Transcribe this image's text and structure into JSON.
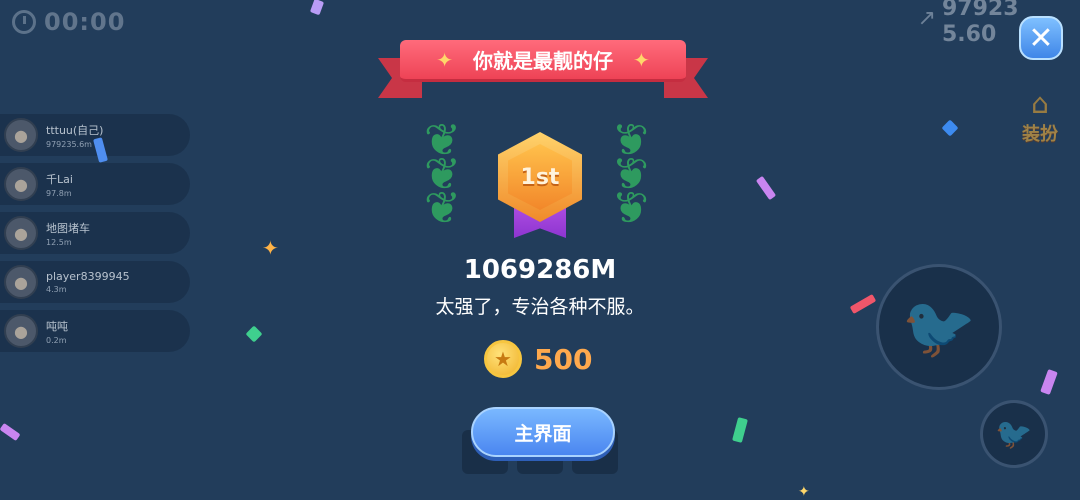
{
  "hud": {
    "timer": "00:00",
    "distance": "979235.60",
    "dress_up_label": "装扮"
  },
  "leaderboard": [
    {
      "name": "tttuu(自己)",
      "score": "979235.6m"
    },
    {
      "name": "千Lai",
      "score": "97.8m"
    },
    {
      "name": "地图堵车",
      "score": "12.5m"
    },
    {
      "name": "player8399945",
      "score": "4.3m"
    },
    {
      "name": "吨吨",
      "score": "0.2m"
    }
  ],
  "result": {
    "banner_title": "你就是最靓的仔",
    "rank_badge": "1st",
    "score": "1069286M",
    "message": "太强了，专治各种不服。",
    "coins": "500",
    "main_menu_button": "主界面"
  },
  "icons": {
    "timer": "clock-icon",
    "distance": "trend-up-icon",
    "close": "close-icon",
    "dress": "hanger-icon",
    "coin": "star-coin-icon"
  },
  "colors": {
    "background": "#223d5b",
    "ribbon": "#ee4356",
    "button": "#4a86f0",
    "coin_text": "#ffa94d",
    "laurel": "#2e9a5f"
  }
}
